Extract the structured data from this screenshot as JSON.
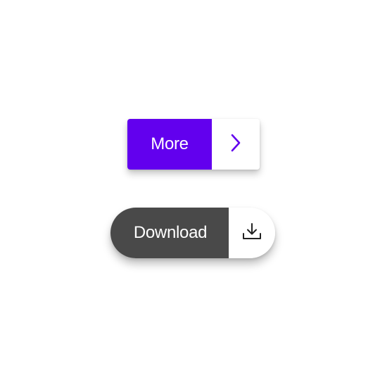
{
  "buttons": {
    "more": {
      "label": "More",
      "icon": "chevron-right-icon",
      "accent_color": "#6200ee"
    },
    "download": {
      "label": "Download",
      "icon": "download-icon",
      "fill_color": "#494949"
    }
  }
}
